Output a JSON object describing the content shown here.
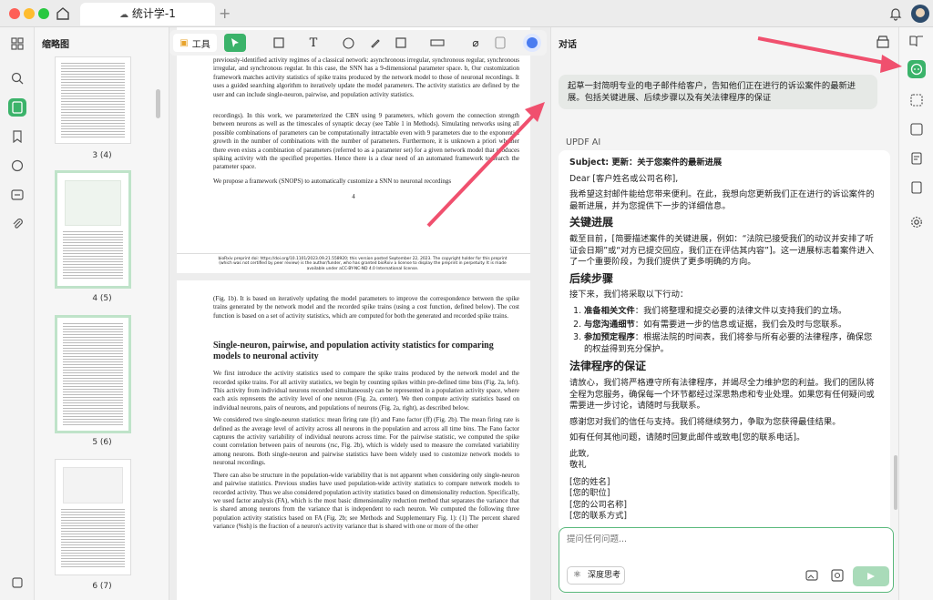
{
  "tab": {
    "title": "统计学-1"
  },
  "thumbnails": {
    "title": "缩略图",
    "pages": [
      {
        "label": "3 (4)"
      },
      {
        "label": "4 (5)"
      },
      {
        "label": "5 (6)"
      },
      {
        "label": "6 (7)"
      }
    ]
  },
  "toolbar": {
    "tools_label": "工具"
  },
  "document": {
    "page_top": {
      "para1": "previously-identified activity regimes of a classical network: asynchronous irregular, synchronous regular, synchronous irregular, and synchronous regular. In this case, the SNN has a 9-dimensional parameter space. b, Our customization framework matches activity statistics of spike trains produced by the network model to those of neuronal recordings. It uses a guided searching algorithm to iteratively update the model parameters. The activity statistics are defined by the user and can include single-neuron, pairwise, and population activity statistics.",
      "para2": "recordings). In this work, we parameterized the CBN using 9 parameters, which govern the connection strength between neurons as well as the timescales of synaptic decay (see Table 1 in Methods). Simulating networks using all possible combinations of parameters can be computationally intractable even with 9 parameters due to the exponential growth in the number of combinations with the number of parameters. Furthermore, it is unknown a priori whether there even exists a combination of parameters (referred to as a parameter set) for a given network model that produces spiking activity with the specified properties. Hence there is a clear need of an automated framework to search the parameter space.",
      "para3": "We propose a framework (SNOPS) to automatically customize a SNN to neuronal recordings",
      "page_number": "4",
      "footer": "bioRxiv preprint doi: https://doi.org/10.1101/2023.09.21.558920; this version posted September 22, 2023. The copyright holder for this preprint (which was not certified by peer review) is the author/funder, who has granted bioRxiv a license to display the preprint in perpetuity. It is made available under aCC-BY-NC-ND 4.0 International license."
    },
    "page_bottom": {
      "para1": "(Fig. 1b). It is based on iteratively updating the model parameters to improve the correspondence between the spike trains generated by the network model and the recorded spike trains (using a cost function, defined below). The cost function is based on a set of activity statistics, which are computed for both the generated and recorded spike trains.",
      "heading": "Single-neuron, pairwise, and population activity statistics for comparing models to neuronal activity",
      "para2": "We first introduce the activity statistics used to compare the spike trains produced by the network model and the recorded spike trains. For all activity statistics, we begin by counting spikes within pre-defined time bins (Fig. 2a, left). This activity from individual neurons recorded simultaneously can be represented in a population activity space, where each axis represents the activity level of one neuron (Fig. 2a, center). We then compute activity statistics based on individual neurons, pairs of neurons, and populations of neurons (Fig. 2a, right), as described below.",
      "para3": "We considered two single-neuron statistics: mean firing rate (fr) and Fano factor (ff) (Fig. 2b). The mean firing rate is defined as the average level of activity across all neurons in the population and across all time bins. The Fano factor captures the activity variability of individual neurons across time. For the pairwise statistic, we computed the spike count correlation between pairs of neurons (rsc, Fig. 2b), which is widely used to measure the correlated variability among neurons. Both single-neuron and pairwise statistics have been widely used to customize network models to neuronal recordings.",
      "para4": "There can also be structure in the population-wide variability that is not apparent when considering only single-neuron and pairwise statistics. Previous studies have used population-wide activity statistics to compare network models to recorded activity. Thus we also considered population activity statistics based on dimensionality reduction. Specifically, we used factor analysis (FA), which is the most basic dimensionality reduction method that separates the variance that is shared among neurons from the variance that is independent to each neuron. We computed the following three population activity statistics based on FA (Fig. 2b; see Methods and Supplementary Fig. 1): (1) The percent shared variance (%sh) is the fraction of a neuron's activity variance that is shared with one or more of the other"
    }
  },
  "chat": {
    "title": "对话",
    "user_message": "起草一封简明专业的电子邮件给客户，告知他们正在进行的诉讼案件的最新进展。包括关键进展、后续步骤以及有关法律程序的保证",
    "ai_label": "UPDF AI",
    "response": {
      "subject": "Subject: 更新：关于您案件的最新进展",
      "greeting": "Dear [客户姓名或公司名称],",
      "intro": "我希望这封邮件能给您带来便利。在此，我想向您更新我们正在进行的诉讼案件的最新进展，并为您提供下一步的详细信息。",
      "h1": "关键进展",
      "p1": "截至目前，[简要描述案件的关键进展，例如：“法院已接受我们的动议并安排了听证会日期”或“对方已提交回应，我们正在评估其内容”]。这一进展标志着案件进入了一个重要阶段，为我们提供了更多明确的方向。",
      "h2": "后续步骤",
      "p2": "接下来，我们将采取以下行动：",
      "steps": [
        {
          "bold": "准备相关文件",
          "text": "：我们将整理和提交必要的法律文件以支持我们的立场。"
        },
        {
          "bold": "与您沟通细节",
          "text": "：如有需要进一步的信息或证据，我们会及时与您联系。"
        },
        {
          "bold": "参加预定程序",
          "text": "：根据法院的时间表，我们将参与所有必要的法律程序，确保您的权益得到充分保护。"
        }
      ],
      "h3": "法律程序的保证",
      "p3": "请放心，我们将严格遵守所有法律程序，并竭尽全力维护您的利益。我们的团队将全程为您服务，确保每一个环节都经过深思熟虑和专业处理。如果您有任何疑问或需要进一步讨论，请随时与我联系。",
      "p4": "感谢您对我们的信任与支持。我们将继续努力，争取为您获得最佳结果。",
      "p5": "如有任何其他问题，请随时回复此邮件或致电[您的联系电话]。",
      "closing1": "此致,",
      "closing2": "敬礼",
      "sig1": "[您的姓名]",
      "sig2": "[您的职位]",
      "sig3": "[您的公司名称]",
      "sig4": "[您的联系方式]"
    },
    "input_placeholder": "提问任何问题...",
    "deep_think_label": "深度思考"
  },
  "colors": {
    "accent": "#3bb36a",
    "arrow": "#f0506e"
  }
}
